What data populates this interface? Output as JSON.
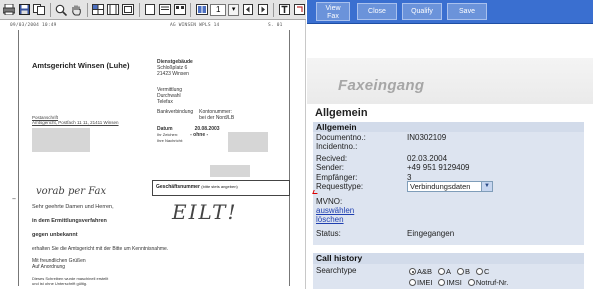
{
  "viewer": {
    "page_value": "1",
    "fax_header": [
      "09/03/2004 10:49",
      "AG WINSEN WPLS 14",
      "S. 01"
    ],
    "court_title": "Amtsgericht Winsen (Luhe)",
    "address": {
      "heading": "Dienstgebäude",
      "street": "Schloßplatz 6",
      "city": "21423 Winsen",
      "fernsprecher": "Vermittlung",
      "durchwahl": "Durchwahl",
      "telefax": "Telefax",
      "bank_label": "Bankverbindung",
      "bank_value_1": "Kontonummer:",
      "bank_value_2": "bei der Nord/LB",
      "datum_label": "Datum",
      "datum_value": "20.08.2003",
      "az_label": "Ihr Zeichen:",
      "az_value": "- ohne -",
      "bearb_label": "Ihre Nachricht:"
    },
    "sender_small_1": "Postanschrift",
    "sender_small_2": "Amtsgericht, Postfach 11 11, 21411 Winsen",
    "geschaeft": "Geschäftsnummer",
    "geschaeft_small": "(bitte stets angeben)",
    "handwriting_1": "vorab per Fax",
    "handwriting_2": "EILT!",
    "salutation": "Sehr geehrte Damen und Herren,",
    "line_proc": "in dem Ermittlungsverfahren",
    "line_unknown": "gegen unbekannt",
    "line_request": "erhalten Sie die Amtsgericht mit der Bitte um Kenntnisnahme.",
    "greeting": "Mit freundlichen Grüßen",
    "greeting_2": "Auf Anordnung",
    "footer": "Dieses Schreiben wurde maschinell erstellt",
    "footer_2": "und ist ohne Unterschrift gültig."
  },
  "panel": {
    "buttons": {
      "view_line1": "View",
      "view_line2": "Fax",
      "close": "Close",
      "qualify": "Qualify",
      "save": "Save"
    },
    "title": "Faxeingang",
    "section_title": "Allgemein",
    "allgemein": {
      "head": "Allgemein",
      "labels": {
        "documentno": "Documentno.:",
        "incidentno": "Incidentno.:",
        "received": "Recived:",
        "sender": "Sender:",
        "empfaenger": "Empfänger:",
        "requesttype": "Requesttype:",
        "mvno": "MVNO:",
        "auswaehlen": "auswählen",
        "loeschen": "löschen",
        "status": "Status:"
      },
      "values": {
        "documentno": "IN0302109",
        "incidentno": "",
        "received": "02.03.2004",
        "sender": "+49 951 9129409",
        "empfaenger": "3",
        "requesttype": "Verbindungsdaten",
        "status": "Eingegangen"
      }
    },
    "call_history": {
      "head": "Call history",
      "searchtype_label": "Searchtype",
      "options_row1": [
        "A&B",
        "A",
        "B",
        "C"
      ],
      "options_row2": [
        "IMEI",
        "IMSI",
        "Notruf-Nr."
      ],
      "selected": "A&B"
    }
  }
}
